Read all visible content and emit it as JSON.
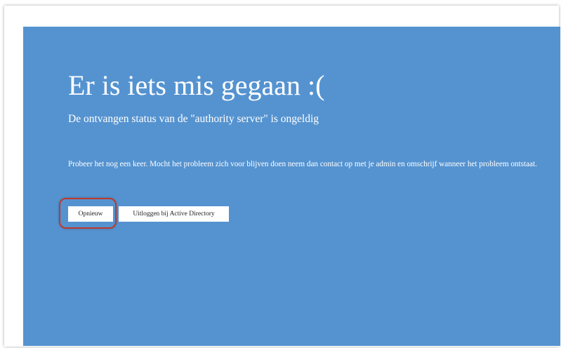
{
  "error": {
    "title": "Er is iets mis gegaan :(",
    "subtitle": "De ontvangen status van de \"authority server\" is ongeldig",
    "message": "Probeer het nog een keer. Mocht het probleem zich voor blijven doen neem dan contact op met je admin en omschrijf wanneer het probleem ontstaat."
  },
  "actions": {
    "retry_label": "Opnieuw",
    "logout_label": "Uitloggen bij Active Directory"
  },
  "colors": {
    "panel_background": "#5593d0",
    "text": "#ffffff",
    "highlight_ring": "#c0392b"
  }
}
